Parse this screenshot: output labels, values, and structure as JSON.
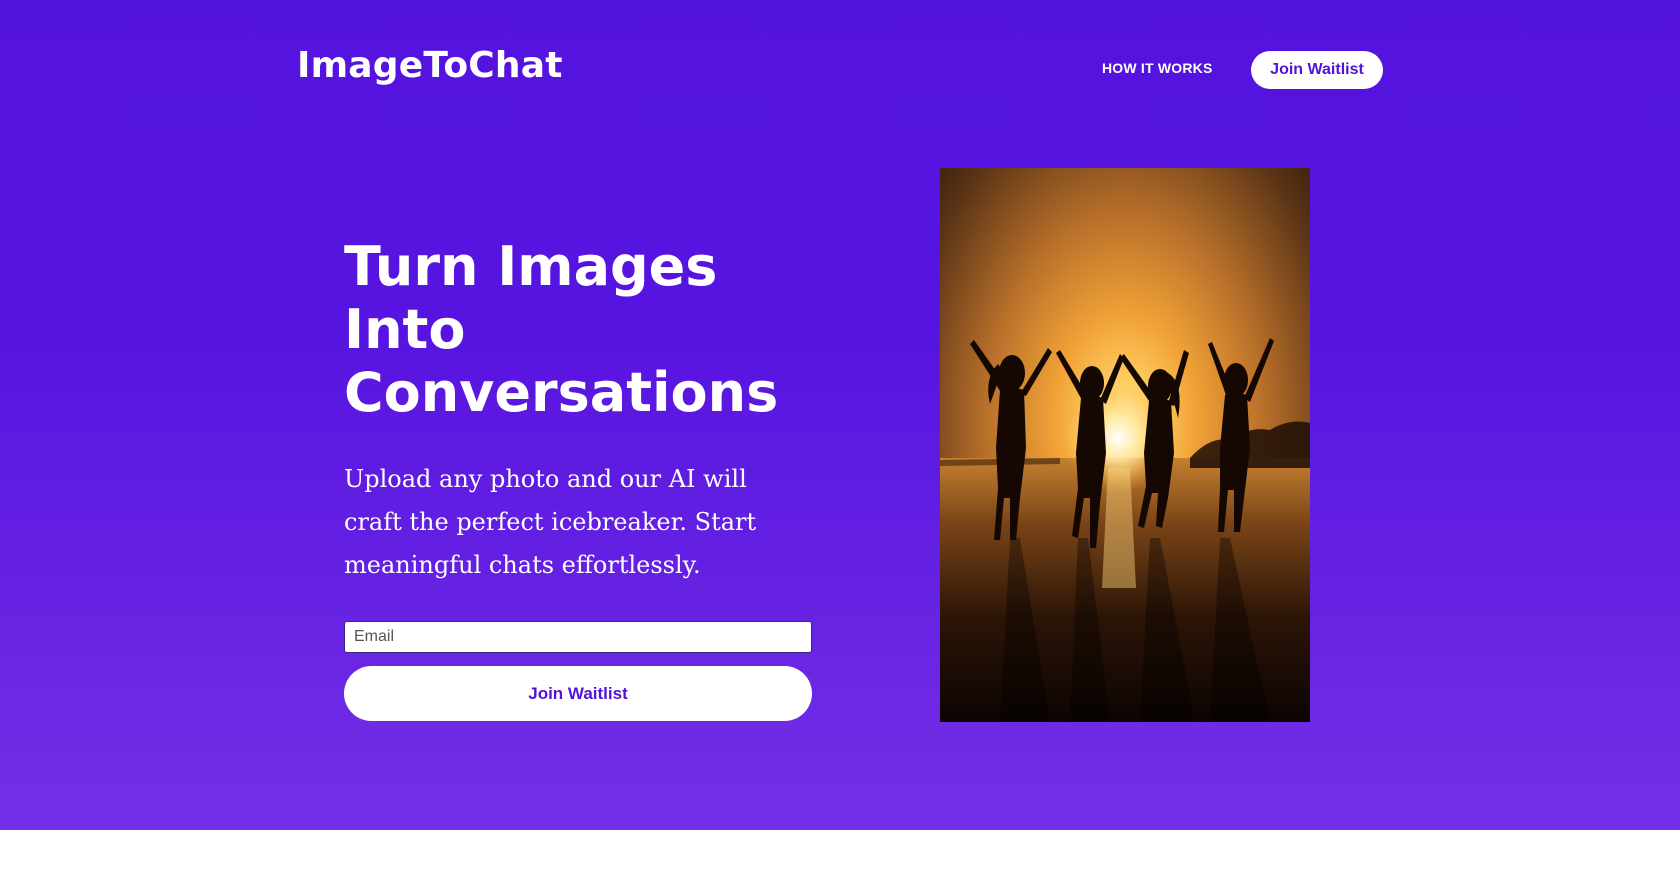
{
  "brand": {
    "logo_text": "ImageToChat"
  },
  "nav": {
    "how_it_works_label": "HOW IT WORKS",
    "join_waitlist_label": "Join Waitlist"
  },
  "hero": {
    "headline_line1": "Turn Images",
    "headline_line2": "Into",
    "headline_line3": "Conversations",
    "subtext": "Upload any photo and our AI will craft the perfect icebreaker. Start meaningful chats effortlessly.",
    "email_placeholder": "Email",
    "email_value": "",
    "join_button_label": "Join Waitlist",
    "image_icon": "sunset-silhouettes-photo"
  },
  "colors": {
    "hero_background": "#5313df",
    "button_background": "#ffffff",
    "button_text": "#5013d8",
    "text": "#ffffff"
  }
}
